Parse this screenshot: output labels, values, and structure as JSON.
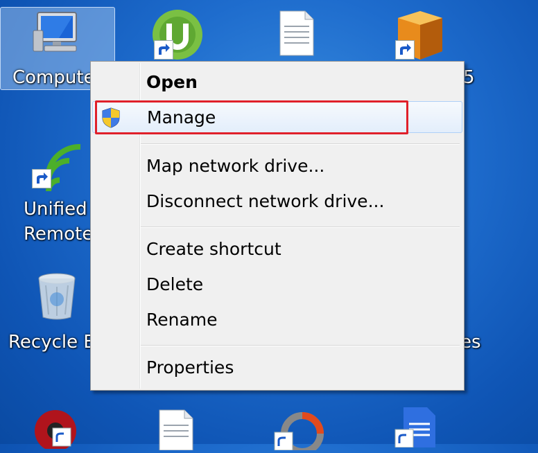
{
  "desktop": {
    "icons": [
      {
        "label": "Computer",
        "name": "computer"
      },
      {
        "label": "Unified Remote",
        "line1": "Unified",
        "line2": "Remote"
      },
      {
        "label": "Recycle Bin",
        "display": "Recycle B"
      },
      {
        "partial_right_top": "5"
      },
      {
        "partial_right_mid": "es"
      }
    ]
  },
  "context_menu": {
    "items": [
      {
        "label": "Open",
        "bold": true
      },
      {
        "label": "Manage",
        "icon": "uac-shield-icon",
        "highlighted": true
      },
      {
        "label": "Map network drive..."
      },
      {
        "label": "Disconnect network drive..."
      },
      {
        "label": "Create shortcut"
      },
      {
        "label": "Delete"
      },
      {
        "label": "Rename"
      },
      {
        "label": "Properties"
      }
    ]
  },
  "colors": {
    "desktop_bg": "#1e6ccd",
    "menu_bg": "#f0f0f0",
    "highlight_border": "#e0202a",
    "hover_border": "#aecff7"
  }
}
